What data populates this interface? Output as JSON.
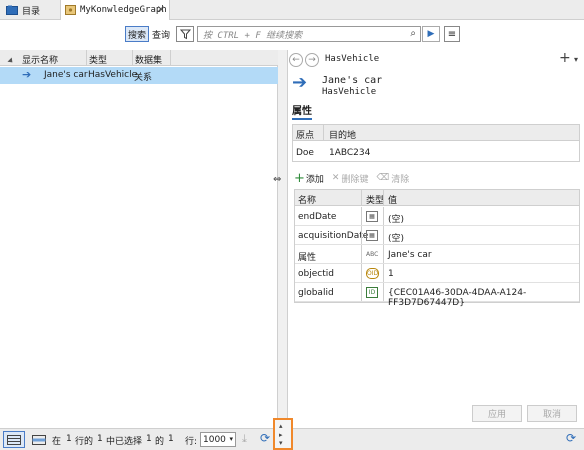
{
  "tabs": [
    {
      "label": "目录",
      "icon": "catalog-icon"
    },
    {
      "label": "MyKonwledgeGraph",
      "icon": "knowledge-graph-icon",
      "close": "×"
    }
  ],
  "toolbar": {
    "search_label": "搜索",
    "query_label": "查询",
    "search_placeholder": "按 CTRL + F 继续搜索"
  },
  "table": {
    "columns": [
      "显示名称",
      "类型",
      "数据集"
    ],
    "rows": [
      {
        "display_name": "Jane's car",
        "type": "HasVehicle",
        "dataset": "关系"
      }
    ]
  },
  "details": {
    "header_type": "HasVehicle",
    "name": "Jane's car",
    "type": "HasVehicle",
    "section_title": "属性",
    "endpoints": {
      "columns": [
        "原点",
        "目的地"
      ],
      "origin": "Doe",
      "destination": "1ABC234"
    },
    "actions": {
      "add": "添加",
      "delete": "删除键",
      "clear": "清除"
    },
    "props_columns": [
      "名称",
      "类型",
      "值"
    ],
    "properties": [
      {
        "name": "endDate",
        "type_icon": "date-icon",
        "type_text": "▦",
        "value": "(空)"
      },
      {
        "name": "acquisitionDate",
        "type_icon": "date-icon",
        "type_text": "▦",
        "value": "(空)"
      },
      {
        "name": "属性",
        "type_icon": "text-icon",
        "type_text": "ABC",
        "value": "Jane's car"
      },
      {
        "name": "objectid",
        "type_icon": "objectid-icon",
        "type_text": "OID",
        "value": "1"
      },
      {
        "name": "globalid",
        "type_icon": "globalid-icon",
        "type_text": "ID",
        "value": "{CEC01A46-30DA-4DAA-A124-FF3D7D67447D}"
      }
    ],
    "apply_label": "应用",
    "cancel_label": "取消"
  },
  "status": {
    "text_in": "在",
    "row": "1",
    "text_rows_of": "行的",
    "total": "1",
    "text_selected": "中已选择",
    "selected": "1",
    "text_of": "的",
    "count": "1",
    "rows_label": "行:",
    "rows_value": "1000"
  }
}
